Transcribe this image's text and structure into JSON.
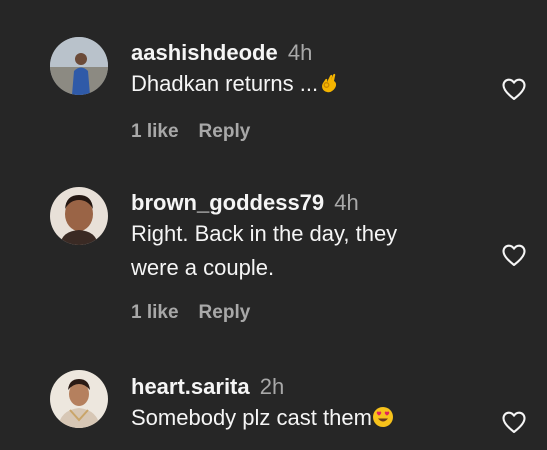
{
  "comments": [
    {
      "username": "aashishdeode",
      "time": "4h",
      "text": "Dhadkan returns ...",
      "emoji": "ok-hand-emoji",
      "likes": "1 like",
      "reply_label": "Reply"
    },
    {
      "username": "brown_goddess79",
      "time": "4h",
      "text_line1": "Right. Back in the day, they",
      "text_line2": "were a couple.",
      "likes": "1 like",
      "reply_label": "Reply"
    },
    {
      "username": "heart.sarita",
      "time": "2h",
      "text": "Somebody plz cast them",
      "emoji": "heart-eyes-emoji"
    }
  ],
  "colors": {
    "background": "#262626",
    "primary_text": "#f5f5f5",
    "secondary_text": "#a8a8a8"
  },
  "icons": {
    "like": "heart-outline-icon"
  }
}
